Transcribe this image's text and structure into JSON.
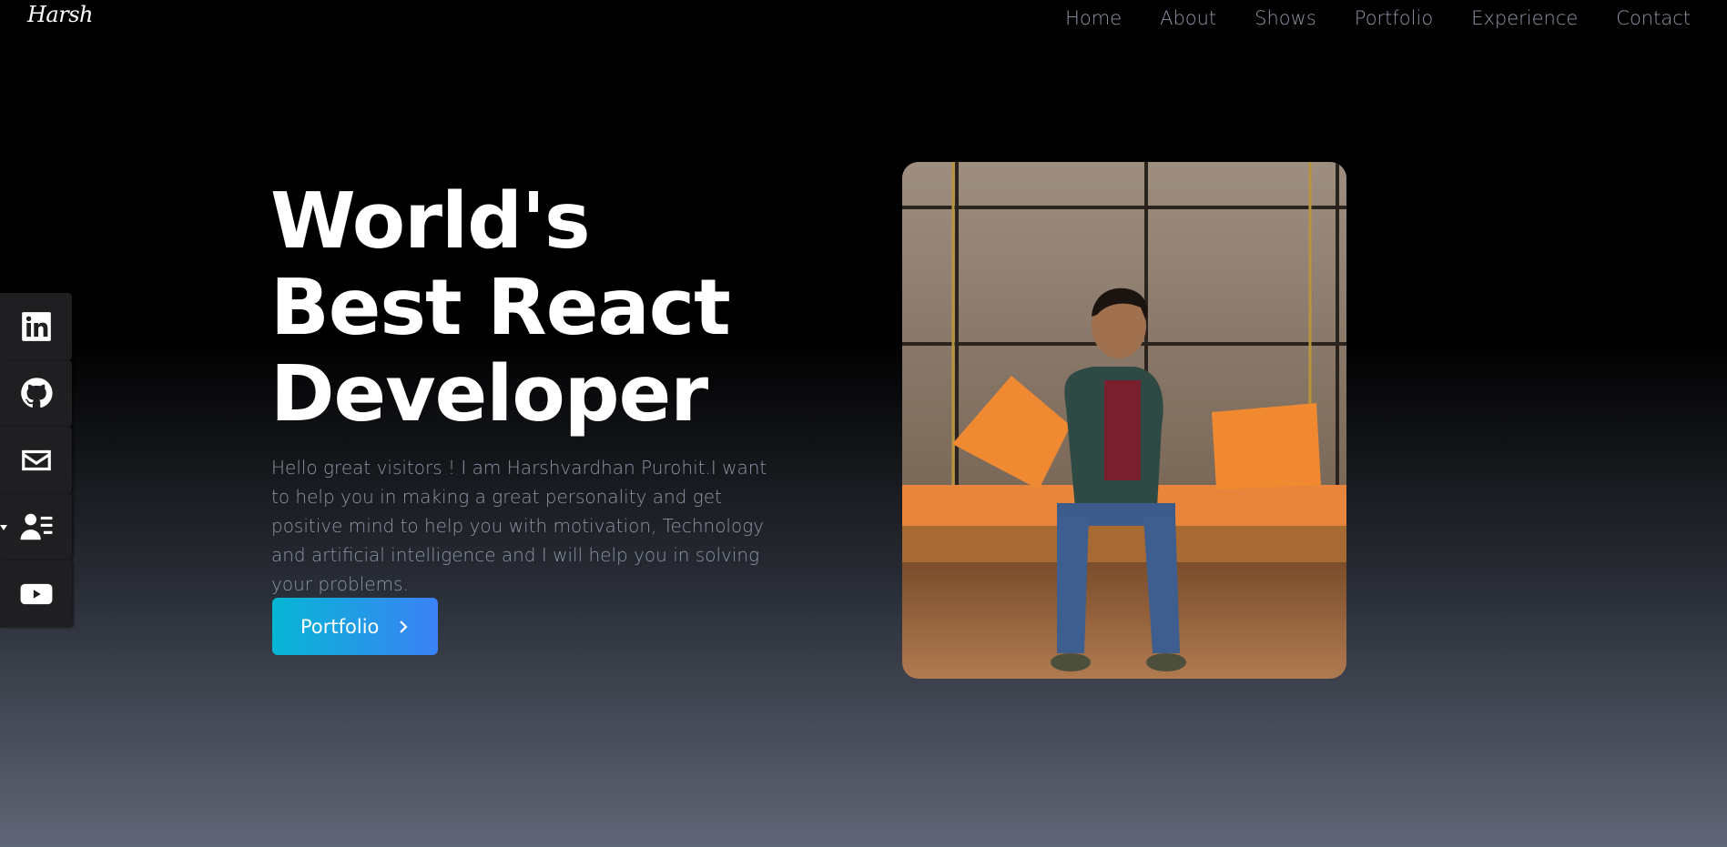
{
  "nav": {
    "logo": "Harsh",
    "links": [
      "Home",
      "About",
      "Shows",
      "Portfolio",
      "Experience",
      "Contact"
    ]
  },
  "socials": [
    "linkedin-icon",
    "github-icon",
    "mail-icon",
    "contact-card-icon",
    "youtube-icon"
  ],
  "hero": {
    "title_line1": "World's",
    "title_line2": "Best React",
    "title_line3": "Developer",
    "description": "Hello great visitors ! I am Harshvardhan Purohit.I want to help you in making a great personality and get positive mind to help you with motivation, Technology and artificial intelligence and I will help you in solving your problems.",
    "cta_label": "Portfolio"
  },
  "colors": {
    "accent_start": "#06b6d4",
    "accent_end": "#3b82f6",
    "nav_text": "#8e96a5"
  }
}
